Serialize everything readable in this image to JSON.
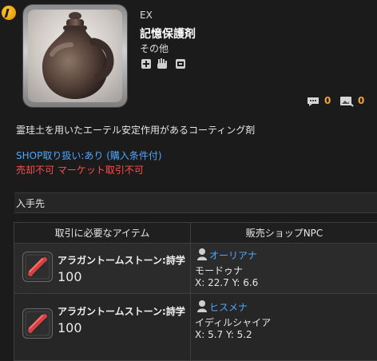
{
  "header": {
    "category_tag": "EX",
    "item_name": "記憶保護剤",
    "item_type": "その他",
    "description": "霊珪土を用いたエーテル安定作用があるコーティング剤",
    "comments_count": "0",
    "gallery_count": "0"
  },
  "shop": {
    "label": "SHOP取り扱い:",
    "value": "あり",
    "extra": "(購入条件付)",
    "restrictions": "売却不可 マーケット取引不可"
  },
  "acquire": {
    "section_title": "入手先",
    "table": {
      "col1_header": "取引に必要なアイテム",
      "col2_header": "販売ショップNPC",
      "rows": [
        {
          "currency_name": "アラガントームストーン:詩学",
          "currency_qty": "100",
          "npc_name": "オーリアナ",
          "npc_location": "モードゥナ",
          "npc_coords": "X: 22.7 Y: 6.6"
        },
        {
          "currency_name": "アラガントームストーン:詩学",
          "currency_qty": "100",
          "npc_name": "ヒスメナ",
          "npc_location": "イディルシャイア",
          "npc_coords": "X: 5.7 Y: 5.2"
        }
      ]
    }
  },
  "icons": {
    "site_logo": "site-logo-icon",
    "comments": "comment-bubble-icon",
    "gallery": "gallery-icon"
  },
  "colors": {
    "background": "#1b1b1b",
    "link_blue": "#4ea6ff",
    "warning_red": "#ff4d4d",
    "counter_orange": "#f0a23a"
  }
}
